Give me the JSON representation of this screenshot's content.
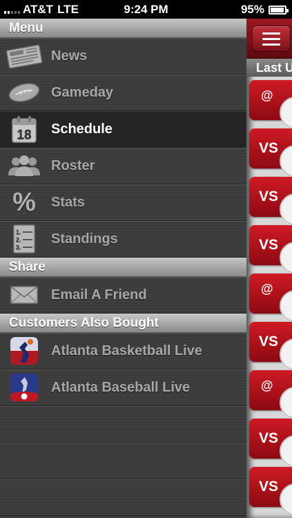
{
  "status_bar": {
    "carrier": "AT&T",
    "network": "LTE",
    "time": "9:24 PM",
    "battery": "95%",
    "battery_level": 0.95
  },
  "menu": {
    "header": "Menu",
    "items": [
      {
        "label": "News",
        "icon": "newspaper-icon"
      },
      {
        "label": "Gameday",
        "icon": "football-icon"
      },
      {
        "label": "Schedule",
        "icon": "calendar-icon",
        "calendar_day": "18",
        "selected": true
      },
      {
        "label": "Roster",
        "icon": "people-icon"
      },
      {
        "label": "Stats",
        "icon": "percent-icon",
        "glyph": "%"
      },
      {
        "label": "Standings",
        "icon": "list-icon",
        "numbers": [
          "1.",
          "2.",
          "3."
        ]
      }
    ]
  },
  "share": {
    "header": "Share",
    "items": [
      {
        "label": "Email A Friend",
        "icon": "envelope-icon"
      }
    ]
  },
  "also_bought": {
    "header": "Customers Also Bought",
    "items": [
      {
        "label": "Atlanta Basketball Live",
        "icon": "basketball-app-icon"
      },
      {
        "label": "Atlanta Baseball Live",
        "icon": "baseball-app-icon"
      }
    ]
  },
  "content": {
    "subheader": "Last U",
    "games": [
      "@",
      "VS",
      "VS",
      "VS",
      "@",
      "VS",
      "@",
      "VS",
      "VS"
    ]
  },
  "colors": {
    "accent_red": "#c0161f",
    "menu_bg": "#3c3c3c"
  }
}
